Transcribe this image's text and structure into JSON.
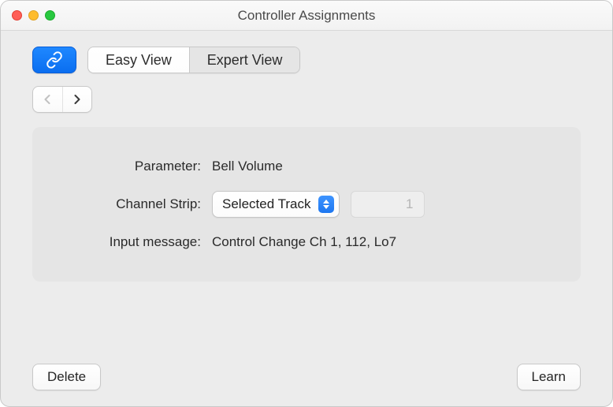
{
  "window": {
    "title": "Controller Assignments"
  },
  "views": {
    "easy": "Easy View",
    "expert": "Expert View"
  },
  "panel": {
    "labels": {
      "parameter": "Parameter:",
      "channel_strip": "Channel Strip:",
      "input_message": "Input message:"
    },
    "parameter_value": "Bell Volume",
    "channel_strip_value": "Selected Track",
    "channel_strip_number": "1",
    "input_message_value": "Control Change Ch 1, 112, Lo7"
  },
  "footer": {
    "delete": "Delete",
    "learn": "Learn"
  }
}
